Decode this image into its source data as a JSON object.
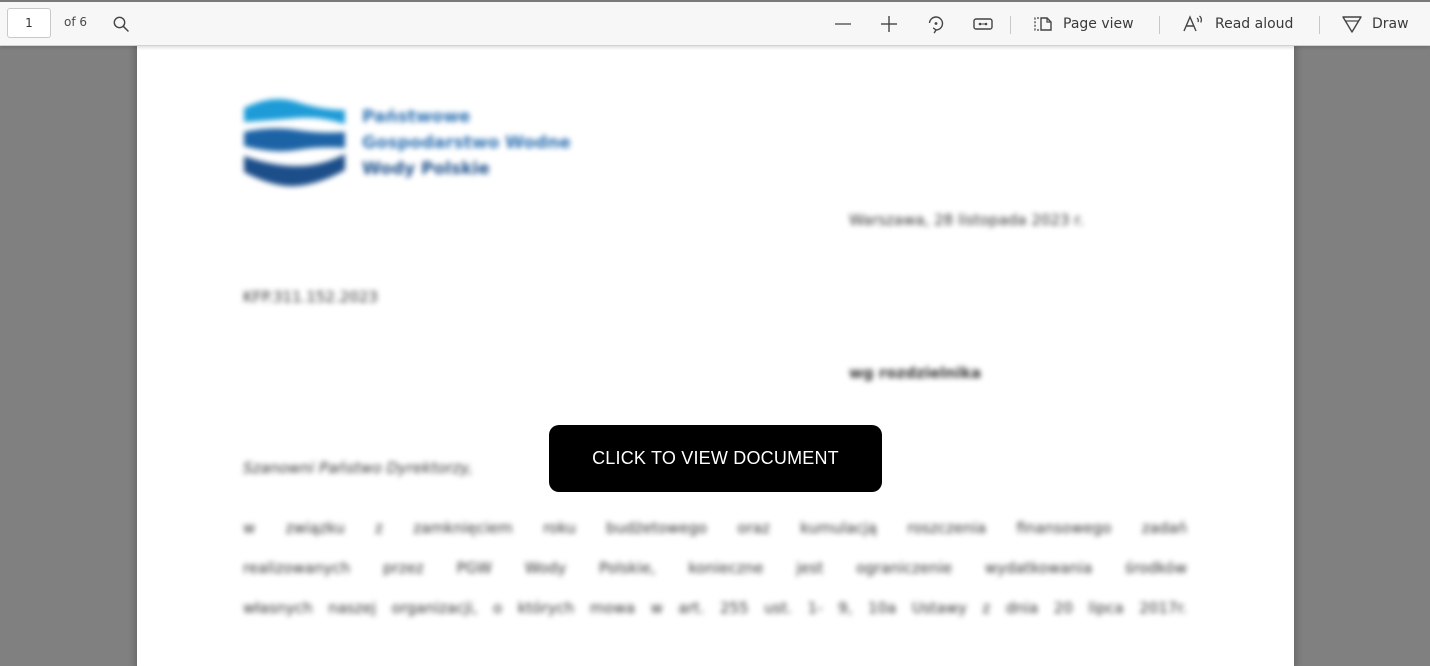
{
  "toolbar": {
    "page_number": "1",
    "page_count": "of 6",
    "icons": {
      "search": "search-icon",
      "zoom_out": "minus-icon",
      "zoom_in": "plus-icon",
      "rotate": "rotate-icon",
      "fit_width": "fit-width-icon",
      "page_view": "page-view-icon",
      "read_aloud": "read-aloud-icon",
      "draw": "draw-icon"
    },
    "page_view_label": "Page view",
    "read_aloud_label": "Read aloud",
    "draw_label": "Draw"
  },
  "document": {
    "logo": {
      "line1": "Państwowe",
      "line2": "Gospodarstwo Wodne",
      "line3": "Wody Polskie",
      "colors": {
        "wave_top": "#1d9bd7",
        "wave_mid": "#1c63a6",
        "wave_bottom": "#1c4e8a"
      }
    },
    "date_line": "Warszawa, 28 listopada 2023 r.",
    "reference": "KFP.311.152.2023",
    "recipient": "wg rozdzielnika",
    "salutation": "Szanowni Państwo Dyrektorzy,",
    "paragraph_lines": [
      "w związku z zamknięciem roku budżetowego oraz kumulacją roszczenia finansowego zadań",
      "realizowanych przez PGW Wody Polskie, konieczne jest ograniczenie wydatkowania środków",
      "własnych naszej organizacji, o których mowa w art. 255 ust. 1- 9, 10a Ustawy z dnia 20 lipca 2017r."
    ]
  },
  "overlay": {
    "button_label": "CLICK TO VIEW DOCUMENT"
  }
}
